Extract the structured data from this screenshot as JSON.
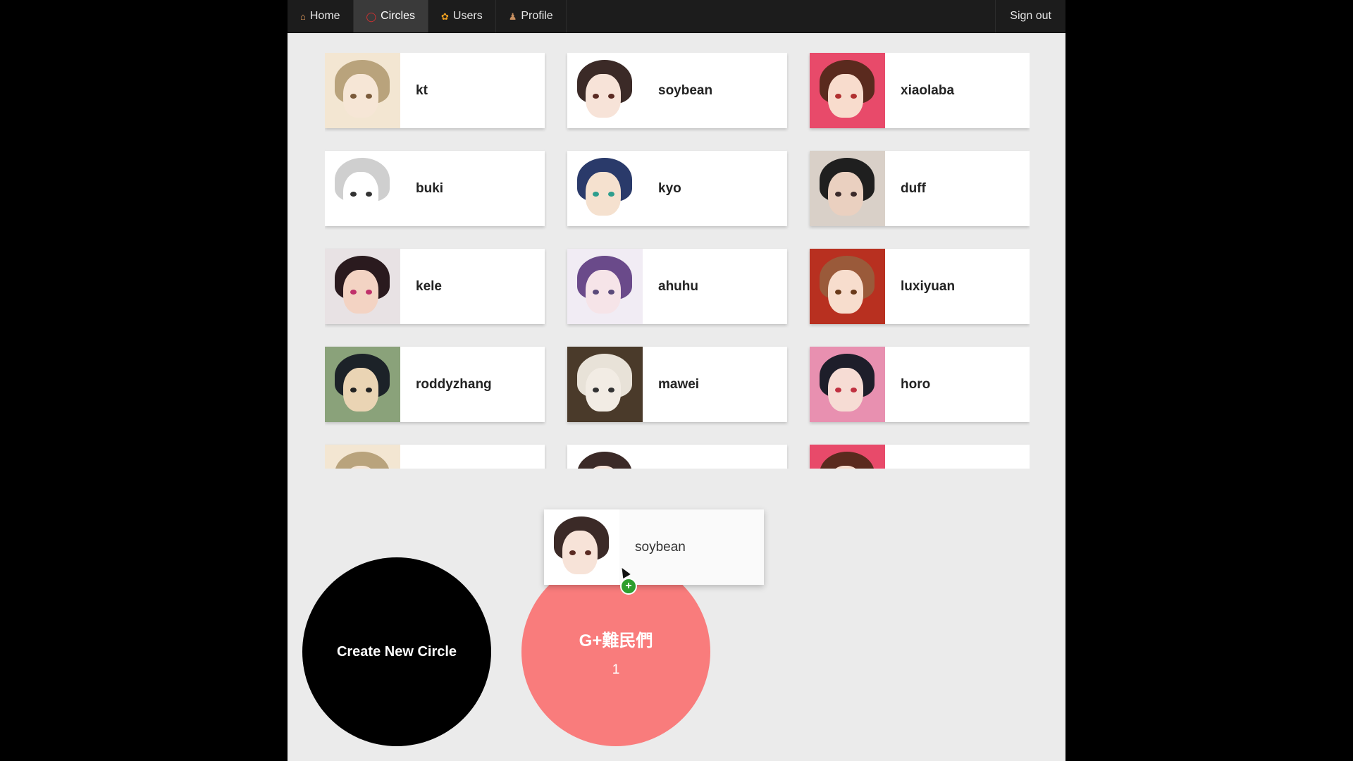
{
  "nav": {
    "items": [
      {
        "label": "Home",
        "icon": "home-icon",
        "active": false
      },
      {
        "label": "Circles",
        "icon": "circle-icon",
        "active": true
      },
      {
        "label": "Users",
        "icon": "users-icon",
        "active": false
      },
      {
        "label": "Profile",
        "icon": "profile-icon",
        "active": false
      }
    ],
    "signout_label": "Sign out"
  },
  "users": [
    {
      "name": "kt",
      "hair": "#b9a37c",
      "skin": "#f6e6d6",
      "bg": "#f3e6d2",
      "eye": "#7a5a3a"
    },
    {
      "name": "soybean",
      "hair": "#3b2a27",
      "skin": "#f7e3d8",
      "bg": "#ffffff",
      "eye": "#5a2a22"
    },
    {
      "name": "xiaolaba",
      "hair": "#5a2a1e",
      "skin": "#f8dccd",
      "bg": "#e84a6a",
      "eye": "#b03030"
    },
    {
      "name": "buki",
      "hair": "#cfcfcf",
      "skin": "#ffffff",
      "bg": "#ffffff",
      "eye": "#333333"
    },
    {
      "name": "kyo",
      "hair": "#2a3a6a",
      "skin": "#f5e1cf",
      "bg": "#ffffff",
      "eye": "#2e9e8e"
    },
    {
      "name": "duff",
      "hair": "#1f1f1f",
      "skin": "#ead0c0",
      "bg": "#d9d0c8",
      "eye": "#3a2a2a"
    },
    {
      "name": "kele",
      "hair": "#2a1a1e",
      "skin": "#f3d3c3",
      "bg": "#e8e2e4",
      "eye": "#c0306a"
    },
    {
      "name": "ahuhu",
      "hair": "#6a4a8a",
      "skin": "#f6e4e8",
      "bg": "#f1ecf4",
      "eye": "#5a4a7a"
    },
    {
      "name": "luxiyuan",
      "hair": "#9a5a3a",
      "skin": "#f7ddcd",
      "bg": "#b83020",
      "eye": "#6a3a1a"
    },
    {
      "name": "roddyzhang",
      "hair": "#1c2228",
      "skin": "#ead4b4",
      "bg": "#8aa27a",
      "eye": "#222222"
    },
    {
      "name": "mawei",
      "hair": "#e8e2d8",
      "skin": "#f2ece4",
      "bg": "#4a3a2a",
      "eye": "#333333"
    },
    {
      "name": "horo",
      "hair": "#1e1e2a",
      "skin": "#f6dcd4",
      "bg": "#e890b0",
      "eye": "#c03040"
    },
    {
      "name": "",
      "hair": "#b9a37c",
      "skin": "#f6e6d6",
      "bg": "#f3e6d2",
      "eye": "#7a5a3a"
    },
    {
      "name": "",
      "hair": "#3b2a27",
      "skin": "#f7e3d8",
      "bg": "#ffffff",
      "eye": "#5a2a22"
    },
    {
      "name": "",
      "hair": "#5a2a1e",
      "skin": "#f8dccd",
      "bg": "#e84a6a",
      "eye": "#b03030"
    }
  ],
  "dragging": {
    "name": "soybean",
    "hair": "#3b2a27",
    "skin": "#f7e3d8",
    "bg": "#ffffff",
    "eye": "#5a2a22"
  },
  "circles": {
    "create_label": "Create New Circle",
    "group_name": "G+難民們",
    "group_count": "1",
    "group_color": "#f97c7c"
  }
}
